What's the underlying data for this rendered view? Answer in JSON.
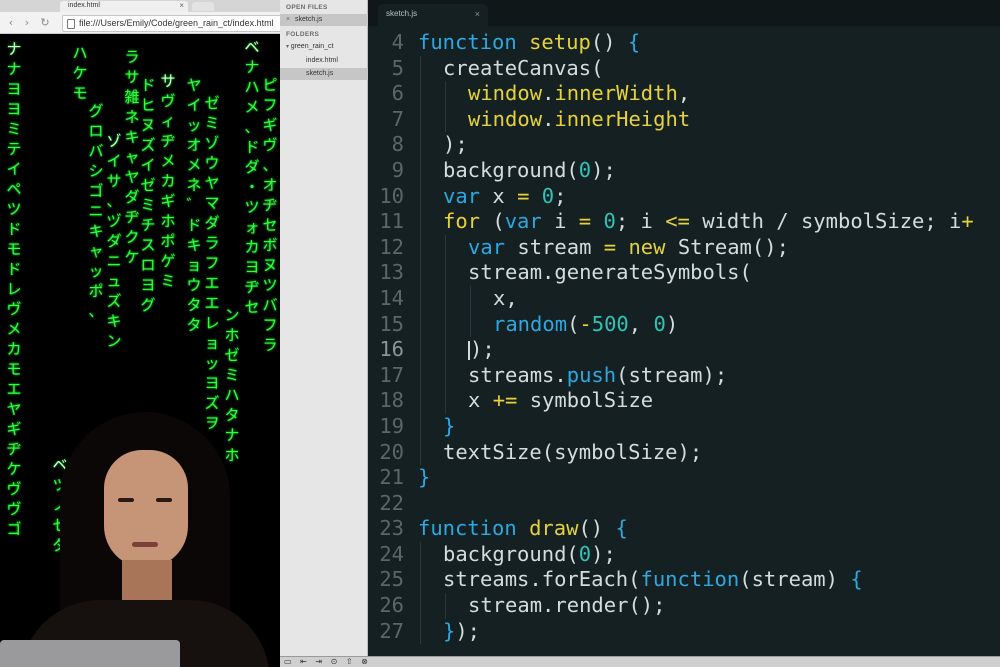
{
  "browser": {
    "tab_title": "index.html",
    "address": "file:///Users/Emily/Code/green_rain_ct/index.html",
    "nav": {
      "back": "‹",
      "forward": "›",
      "reload": "↻"
    }
  },
  "rain": {
    "color": "#2cff3e",
    "streams": [
      "ナナヨヨミテイペツドモドレヴメカモエヤギヂケヴヴゴ",
      "ハケモ",
      "グロバシゴニキャッポ、",
      "ゾイサ、ヅダニュズキン",
      "ラサ雑ネキャヤダヂクケ",
      "ドヒヌズイゼミチスロヨグ",
      "サヴィヂメカギホポゲミ",
      "ゼミゾウヤマダラフエエレョッヨズヲ",
      "ンホゼミハタナホ",
      "ベナハメ、ドダ・ツォカヨヂセ",
      "ピフギヴ、オヂセボヌツバフラ",
      "ヤイッオメネ゛ドキョウタタ",
      "ベツノゼダ"
    ]
  },
  "sidebar": {
    "open_files_header": "OPEN FILES",
    "open_files": [
      "sketch.js"
    ],
    "folders_header": "FOLDERS",
    "folder_name": "green_rain_ct",
    "folder_files": [
      "index.html",
      "sketch.js"
    ]
  },
  "editor": {
    "tab_label": "sketch.js",
    "current_line": 16,
    "lines": [
      {
        "n": "4",
        "indent": 0
      },
      {
        "n": "5",
        "indent": 1
      },
      {
        "n": "6",
        "indent": 2
      },
      {
        "n": "7",
        "indent": 2
      },
      {
        "n": "8",
        "indent": 1
      },
      {
        "n": "9",
        "indent": 1
      },
      {
        "n": "10",
        "indent": 1
      },
      {
        "n": "11",
        "indent": 1
      },
      {
        "n": "12",
        "indent": 2
      },
      {
        "n": "13",
        "indent": 2
      },
      {
        "n": "14",
        "indent": 3
      },
      {
        "n": "15",
        "indent": 3
      },
      {
        "n": "16",
        "indent": 2
      },
      {
        "n": "17",
        "indent": 2
      },
      {
        "n": "18",
        "indent": 2
      },
      {
        "n": "19",
        "indent": 1
      },
      {
        "n": "20",
        "indent": 1
      },
      {
        "n": "21",
        "indent": 0
      },
      {
        "n": "22",
        "indent": 0
      },
      {
        "n": "23",
        "indent": 0
      },
      {
        "n": "24",
        "indent": 1
      },
      {
        "n": "25",
        "indent": 1
      },
      {
        "n": "26",
        "indent": 2
      },
      {
        "n": "27",
        "indent": 1
      }
    ],
    "tokens": [
      [
        [
          "kw",
          "function"
        ],
        [
          "plain",
          " "
        ],
        [
          "fn",
          "setup"
        ],
        [
          "plain",
          "() "
        ],
        [
          "kw",
          "{"
        ]
      ],
      [
        [
          "plain",
          "createCanvas("
        ]
      ],
      [
        [
          "fn",
          "window"
        ],
        [
          "plain",
          "."
        ],
        [
          "fn",
          "innerWidth"
        ],
        [
          "plain",
          ","
        ]
      ],
      [
        [
          "fn",
          "window"
        ],
        [
          "plain",
          "."
        ],
        [
          "fn",
          "innerHeight"
        ]
      ],
      [
        [
          "plain",
          ");"
        ]
      ],
      [
        [
          "plain",
          "background("
        ],
        [
          "num",
          "0"
        ],
        [
          "plain",
          ");"
        ]
      ],
      [
        [
          "kw",
          "var"
        ],
        [
          "plain",
          " x "
        ],
        [
          "op",
          "="
        ],
        [
          "plain",
          " "
        ],
        [
          "num",
          "0"
        ],
        [
          "plain",
          ";"
        ]
      ],
      [
        [
          "fn",
          "for"
        ],
        [
          "plain",
          " ("
        ],
        [
          "kw",
          "var"
        ],
        [
          "plain",
          " i "
        ],
        [
          "op",
          "="
        ],
        [
          "plain",
          " "
        ],
        [
          "num",
          "0"
        ],
        [
          "plain",
          "; i "
        ],
        [
          "op",
          "<="
        ],
        [
          "plain",
          " width / symbolSize; i"
        ],
        [
          "op",
          "+"
        ]
      ],
      [
        [
          "kw",
          "var"
        ],
        [
          "plain",
          " stream "
        ],
        [
          "op",
          "="
        ],
        [
          "plain",
          " "
        ],
        [
          "op",
          "new"
        ],
        [
          "plain",
          " Stream();"
        ]
      ],
      [
        [
          "plain",
          "stream.generateSymbols("
        ]
      ],
      [
        [
          "plain",
          "x,"
        ]
      ],
      [
        [
          "kw",
          "random"
        ],
        [
          "plain",
          "("
        ],
        [
          "op",
          "-"
        ],
        [
          "num",
          "500"
        ],
        [
          "plain",
          ", "
        ],
        [
          "num",
          "0"
        ],
        [
          "plain",
          ")"
        ]
      ],
      [
        [
          "cursor",
          ""
        ],
        [
          "plain",
          ");"
        ]
      ],
      [
        [
          "plain",
          "streams."
        ],
        [
          "kw",
          "push"
        ],
        [
          "plain",
          "(stream);"
        ]
      ],
      [
        [
          "plain",
          "x "
        ],
        [
          "op",
          "+="
        ],
        [
          "plain",
          " symbolSize"
        ]
      ],
      [
        [
          "kw",
          "}"
        ]
      ],
      [
        [
          "plain",
          "textSize(symbolSize);"
        ]
      ],
      [
        [
          "kw",
          "}"
        ]
      ],
      [
        [
          "plain",
          ""
        ]
      ],
      [
        [
          "kw",
          "function"
        ],
        [
          "plain",
          " "
        ],
        [
          "fn",
          "draw"
        ],
        [
          "plain",
          "() "
        ],
        [
          "kw",
          "{"
        ]
      ],
      [
        [
          "plain",
          "background("
        ],
        [
          "num",
          "0"
        ],
        [
          "plain",
          ");"
        ]
      ],
      [
        [
          "plain",
          "streams.forEach("
        ],
        [
          "kw",
          "function"
        ],
        [
          "plain",
          "(stream) "
        ],
        [
          "kw",
          "{"
        ]
      ],
      [
        [
          "plain",
          "stream.render();"
        ]
      ],
      [
        [
          "kw",
          "}"
        ],
        [
          "plain",
          ");"
        ]
      ]
    ]
  },
  "colors": {
    "editor_bg": "#152022",
    "keyword": "#2ea8e0",
    "function": "#e6d33a",
    "number": "#2ec4b6",
    "rain": "#2cff3e"
  }
}
